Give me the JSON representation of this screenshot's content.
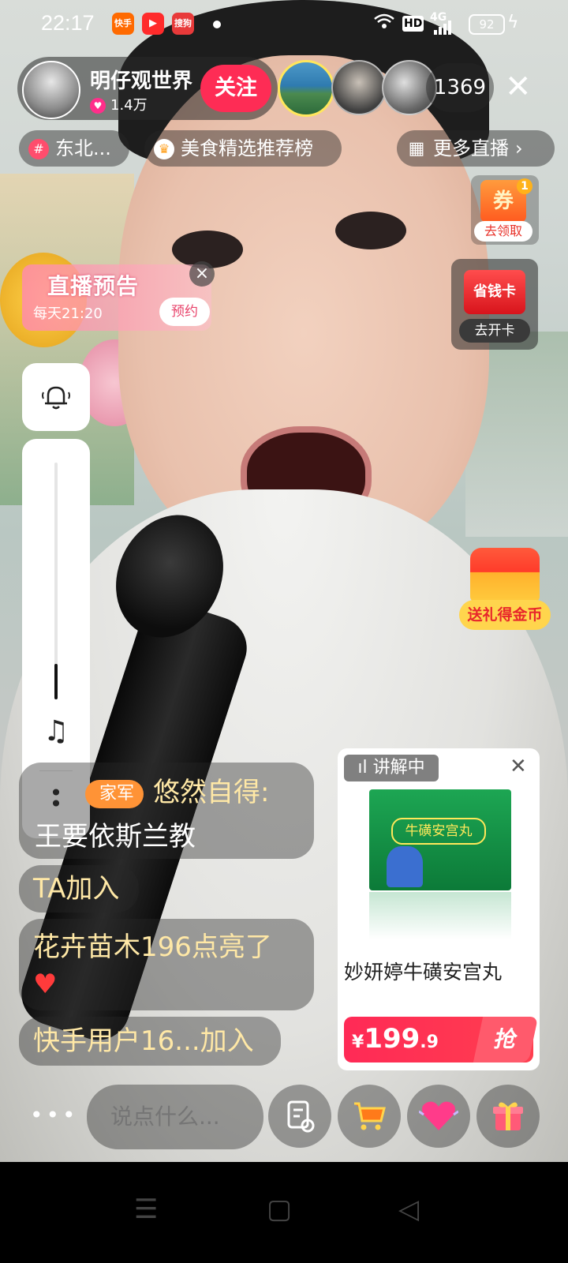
{
  "status_bar": {
    "time": "22:17",
    "apps": [
      "快手",
      "▶",
      "搜狗"
    ],
    "hd": "HD",
    "network": "4G",
    "battery": "92"
  },
  "host": {
    "name": "明仔观世界",
    "likes": "1.4万",
    "follow_label": "关注"
  },
  "viewer_count": "1369",
  "tags": {
    "topic": "东北...",
    "rank": "美食精选推荐榜",
    "more_live": "更多直播"
  },
  "coupon": {
    "face": "券",
    "badge": "1",
    "label": "去领取"
  },
  "save_card": {
    "face": "省钱卡",
    "label": "去开卡"
  },
  "live_preview": {
    "title": "直播预告",
    "schedule": "每天21:20",
    "book_label": "预约"
  },
  "volume": {
    "level": 0.15
  },
  "comments": [
    {
      "badge": "家军",
      "user": "悠然自得:",
      "text": "王要依斯兰教"
    },
    {
      "text": "TA加入"
    },
    {
      "text": "花卉苗木196点亮了"
    },
    {
      "text": "快手用户16...加入"
    }
  ],
  "product": {
    "status": "讲解中",
    "box_text": "牛磺安宫丸",
    "title": "妙妍婷牛磺安宫丸",
    "price_currency": "¥",
    "price_main": "199",
    "price_decimal": ".9",
    "grab_label": "抢"
  },
  "gift_promo": {
    "label": "送礼得金币"
  },
  "input": {
    "placeholder": "说点什么..."
  },
  "colors": {
    "accent": "#fe2c55",
    "comment_text": "#ffe8a6",
    "gold_badge": "#ffd54d"
  }
}
